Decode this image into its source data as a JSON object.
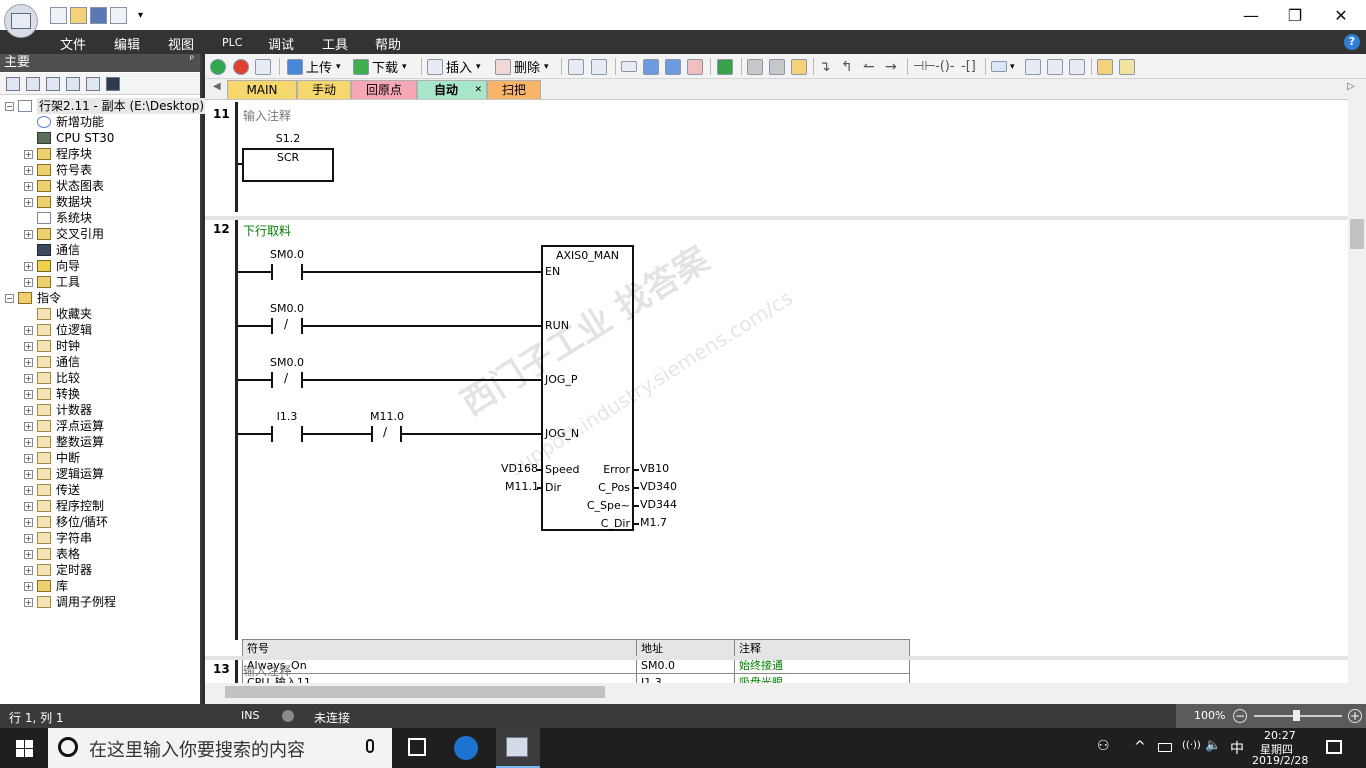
{
  "window": {
    "qat_arrow": "▾",
    "controls": {
      "minimize": "—",
      "maximize": "❐",
      "close": "✕"
    }
  },
  "menu": [
    "文件",
    "编辑",
    "视图",
    "PLC",
    "调试",
    "工具",
    "帮助"
  ],
  "help_icon": "?",
  "left_panel": {
    "title": "主要",
    "pin": "ᵖ",
    "tree": [
      {
        "label": "行架2.11 - 副本 (E:\\Desktop)",
        "expander": "−",
        "icon": "project-icon"
      },
      {
        "label": "新增功能",
        "icon": "question-icon"
      },
      {
        "label": "CPU ST30",
        "icon": "cpu-icon"
      },
      {
        "label": "程序块",
        "expander": "+",
        "icon": "folder-icon"
      },
      {
        "label": "符号表",
        "expander": "+",
        "icon": "folder-icon"
      },
      {
        "label": "状态图表",
        "expander": "+",
        "icon": "folder-icon"
      },
      {
        "label": "数据块",
        "expander": "+",
        "icon": "folder-icon"
      },
      {
        "label": "系统块",
        "icon": "doc-icon"
      },
      {
        "label": "交叉引用",
        "expander": "+",
        "icon": "folder-icon"
      },
      {
        "label": "通信",
        "icon": "network-icon"
      },
      {
        "label": "向导",
        "expander": "+",
        "icon": "wizard-icon"
      },
      {
        "label": "工具",
        "expander": "+",
        "icon": "folder-icon"
      },
      {
        "label": "指令",
        "expander": "−",
        "icon": "folder-icon"
      },
      {
        "label": "收藏夹",
        "icon": "instruction-icon"
      },
      {
        "label": "位逻辑",
        "expander": "+",
        "icon": "instruction-icon"
      },
      {
        "label": "时钟",
        "expander": "+",
        "icon": "instruction-icon"
      },
      {
        "label": "通信",
        "expander": "+",
        "icon": "instruction-icon"
      },
      {
        "label": "比较",
        "expander": "+",
        "icon": "instruction-icon"
      },
      {
        "label": "转换",
        "expander": "+",
        "icon": "instruction-icon"
      },
      {
        "label": "计数器",
        "expander": "+",
        "icon": "instruction-icon"
      },
      {
        "label": "浮点运算",
        "expander": "+",
        "icon": "instruction-icon"
      },
      {
        "label": "整数运算",
        "expander": "+",
        "icon": "instruction-icon"
      },
      {
        "label": "中断",
        "expander": "+",
        "icon": "instruction-icon"
      },
      {
        "label": "逻辑运算",
        "expander": "+",
        "icon": "instruction-icon"
      },
      {
        "label": "传送",
        "expander": "+",
        "icon": "instruction-icon"
      },
      {
        "label": "程序控制",
        "expander": "+",
        "icon": "instruction-icon"
      },
      {
        "label": "移位/循环",
        "expander": "+",
        "icon": "instruction-icon"
      },
      {
        "label": "字符串",
        "expander": "+",
        "icon": "instruction-icon"
      },
      {
        "label": "表格",
        "expander": "+",
        "icon": "instruction-icon"
      },
      {
        "label": "定时器",
        "expander": "+",
        "icon": "instruction-icon"
      },
      {
        "label": "库",
        "expander": "+",
        "icon": "folder-icon"
      },
      {
        "label": "调用子例程",
        "expander": "+",
        "icon": "instruction-icon"
      }
    ]
  },
  "toolbar": {
    "upload": "上传",
    "download": "下载",
    "insert": "插入",
    "delete": "删除",
    "dropdown_arrow": "▾"
  },
  "tabs": {
    "scroll_left": "◀",
    "scroll_right": "▷",
    "items": [
      {
        "label": "MAIN",
        "color": "#f5d76e"
      },
      {
        "label": "手动",
        "color": "#f5d76e"
      },
      {
        "label": "回原点",
        "color": "#f6a7b5"
      },
      {
        "label": "自动",
        "color": "#a9e6c9",
        "active": true,
        "close": "✕"
      },
      {
        "label": "扫把",
        "color": "#f7b56b"
      }
    ]
  },
  "networks": {
    "n11": {
      "number": "11",
      "comment": "输入注释",
      "scr_address": "S1.2",
      "scr_label": "SCR"
    },
    "n12": {
      "number": "12",
      "comment": "下行取料",
      "block_name": "AXIS0_MAN",
      "contacts": [
        {
          "address": "SM0.0",
          "negated": false
        },
        {
          "address": "SM0.0",
          "negated": true,
          "slash": "/"
        },
        {
          "address": "SM0.0",
          "negated": true,
          "slash": "/"
        },
        {
          "address": "I1.3",
          "negated": false
        },
        {
          "address": "M11.0",
          "negated": true,
          "slash": "/"
        }
      ],
      "inputs": [
        "EN",
        "RUN",
        "JOG_P",
        "JOG_N",
        "Speed",
        "Dir"
      ],
      "input_operands": {
        "Speed": "VD168",
        "Dir": "M11.1"
      },
      "outputs": [
        "Error",
        "C_Pos",
        "C_Spe~",
        "C_Dir"
      ],
      "output_operands": {
        "Error": "VB10",
        "C_Pos": "VD340",
        "C_Spe~": "VD344",
        "C_Dir": "M1.7"
      }
    },
    "n13": {
      "number": "13",
      "comment": "输入注释"
    }
  },
  "symbol_table": {
    "headers": [
      "符号",
      "地址",
      "注释"
    ],
    "rows": [
      [
        "Always_On",
        "SM0.0",
        "始终接通"
      ],
      [
        "CPU_输入11",
        "I1.3",
        "吸盘光眼"
      ]
    ]
  },
  "watermark": {
    "line1": "西门子工业  找答案",
    "line2": "support.industry.siemens.com/cs"
  },
  "statusbar": {
    "position": "行 1, 列 1",
    "mode": "INS",
    "connection": "未连接",
    "zoom": "100%",
    "zoom_minus": "−",
    "zoom_plus": "+"
  },
  "taskbar": {
    "search_placeholder": "在这里输入你要搜索的内容",
    "time": "20:27",
    "weekday": "星期四",
    "date": "2019/2/28",
    "ime": "中",
    "tray_arrow": "^",
    "wifi": "((·))",
    "volume": "🔈"
  },
  "colors": {
    "comment_green": "#008000"
  }
}
